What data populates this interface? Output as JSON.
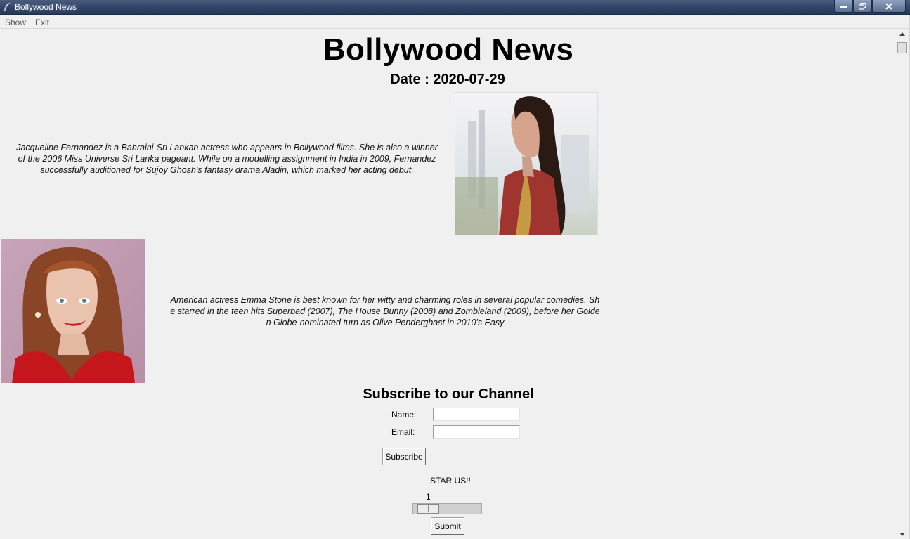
{
  "window": {
    "title": "Bollywood  News"
  },
  "menu": {
    "items": [
      {
        "label": "Show"
      },
      {
        "label": "Exit"
      }
    ]
  },
  "page": {
    "title": "Bollywood News",
    "date_label": "Date : ",
    "date_value": "2020-07-29"
  },
  "articles": [
    {
      "text": "Jacqueline Fernandez is a Bahraini-Sri Lankan actress who appears in Bollywood films. She is also a winner of the 2006 Miss Universe Sri Lanka pageant. While on a modelling assignment in India in 2009, Fernandez successfully auditioned for Sujoy Ghosh's fantasy drama Aladin, which marked her acting debut."
    },
    {
      "text": "American actress Emma Stone is best known for her witty and charming roles in several popular comedies. She starred in the teen hits Superbad (2007), The House Bunny (2008) and Zombieland (2009), before her Golden Globe-nominated turn as Olive Penderghast in 2010's Easy"
    }
  ],
  "subscribe": {
    "heading": "Subscribe to our Channel",
    "name_label": "Name:",
    "name_value": "",
    "email_label": "Email:",
    "email_value": "",
    "button_label": "Subscribe"
  },
  "rating": {
    "label": "STAR US!!",
    "value": 1,
    "value_text": "1",
    "min": 1,
    "max": 5,
    "submit_label": "Submit"
  },
  "colors": {
    "titlebar": "#34476a",
    "background": "#f0f0f0"
  }
}
